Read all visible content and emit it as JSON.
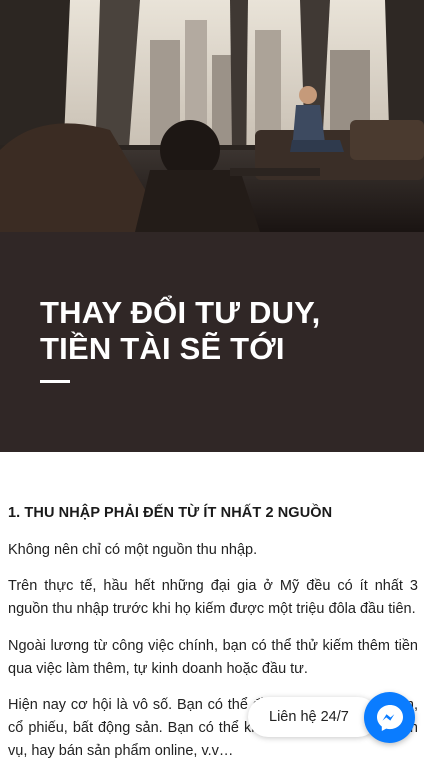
{
  "hero": {
    "title_line1": "THAY ĐỔI TƯ DUY,",
    "title_line2": "TIỀN TÀI SẼ TỚI",
    "photo_icon": "office-businessmen-photo",
    "band_color": "#302726"
  },
  "article": {
    "heading": "1. THU NHẬP PHẢI ĐẾN TỪ ÍT NHẤT 2 NGUỒN",
    "paragraphs": [
      "Không nên chỉ có một nguồn thu nhập.",
      "Trên thực tế, hầu hết những đại gia ở Mỹ đều có ít nhất 3 nguồn thu nhập trước khi họ kiếm được một triệu đôla đầu tiên.",
      "Ngoài lương từ công việc chính, bạn có thể thử kiếm thêm tiền qua việc làm thêm, tự kinh doanh hoặc đầu tư.",
      "Hiện nay cơ hội là vô số. Bạn có thể đầu tư vào chứng khoán, cổ phiếu, bất động sản. Bạn có thể kinh doanh hàng hóa, dịch vụ, hay bán sản phẩm online, v.v…"
    ]
  },
  "contact": {
    "label": "Liên hệ 24/7",
    "icon": "messenger-icon",
    "accent_color": "#0a7cff"
  }
}
